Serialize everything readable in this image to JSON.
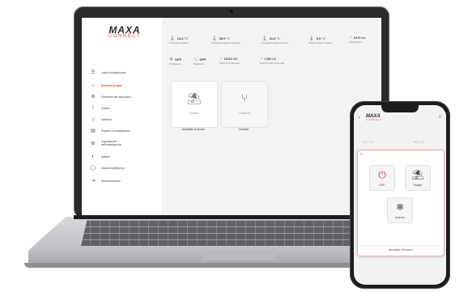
{
  "brand": {
    "name": "MAXA",
    "sub": "CONNECT"
  },
  "sidebar": {
    "items": [
      {
        "icon": "list-icon",
        "glyph": "☰",
        "label": "Lista di installazione"
      },
      {
        "icon": "home-icon",
        "glyph": "⌂",
        "label": "Schema di casa",
        "active": true
      },
      {
        "icon": "gear-icon",
        "glyph": "⚙",
        "label": "Parametri del dispositivo"
      },
      {
        "icon": "chart-icon",
        "glyph": "⌇",
        "label": "Grafico"
      },
      {
        "icon": "bell-icon",
        "glyph": "♫",
        "label": "Notifiche"
      },
      {
        "icon": "register-icon",
        "glyph": "▤",
        "label": "Registro di installazione"
      },
      {
        "icon": "settings-icon",
        "glyph": "⚙",
        "label": "Impostazioni dell'installazione"
      },
      {
        "icon": "language-icon",
        "glyph": "◐",
        "label": "Italiano"
      },
      {
        "icon": "user-icon",
        "glyph": "◯",
        "label": "maxa.test@jbum.pl"
      },
      {
        "icon": "logout-icon",
        "glyph": "⇥",
        "label": "Disconnessione"
      }
    ]
  },
  "readouts_top": [
    {
      "value": "14.4",
      "unit": "°C",
      "label": "Temperatura esterna"
    },
    {
      "value": "35.9",
      "unit": "°C",
      "label": "Temperatura acqua in ingresso"
    },
    {
      "value": "31.6",
      "unit": "°C",
      "label": "Temperatura acqua in uscita"
    },
    {
      "value": "5.0",
      "unit": "°C",
      "label": "Setpoint attuale in uscita"
    },
    {
      "value": "10.9",
      "unit": "bar",
      "label": "Alta pressione"
    }
  ],
  "readouts_bottom": [
    {
      "value": "OFF",
      "unit": "",
      "label": "Sbrinamento"
    },
    {
      "value": "OFF",
      "unit": "",
      "label": "Resistenza"
    },
    {
      "value": "13.62",
      "unit": "kW",
      "label": "Potenza termica resa"
    },
    {
      "value": "1.65",
      "unit": "kW",
      "label": "Potenza totale consumata"
    }
  ],
  "cards": [
    {
      "label": "Estate",
      "footer": "Modalità di lavoro"
    },
    {
      "label": "Comfort",
      "footer": "Comfort"
    }
  ],
  "phone": {
    "readouts": [
      "14.7 °C",
      "35.9 °C"
    ],
    "modes": [
      {
        "label": "OFF",
        "icon": "power-icon"
      },
      {
        "label": "Estate",
        "icon": "summer-icon"
      },
      {
        "label": "Inverno",
        "icon": "winter-icon"
      }
    ],
    "footer": "Modalità di lavoro"
  },
  "colors": {
    "accent": "#d43c3c",
    "brand_red": "#e24a4a"
  }
}
